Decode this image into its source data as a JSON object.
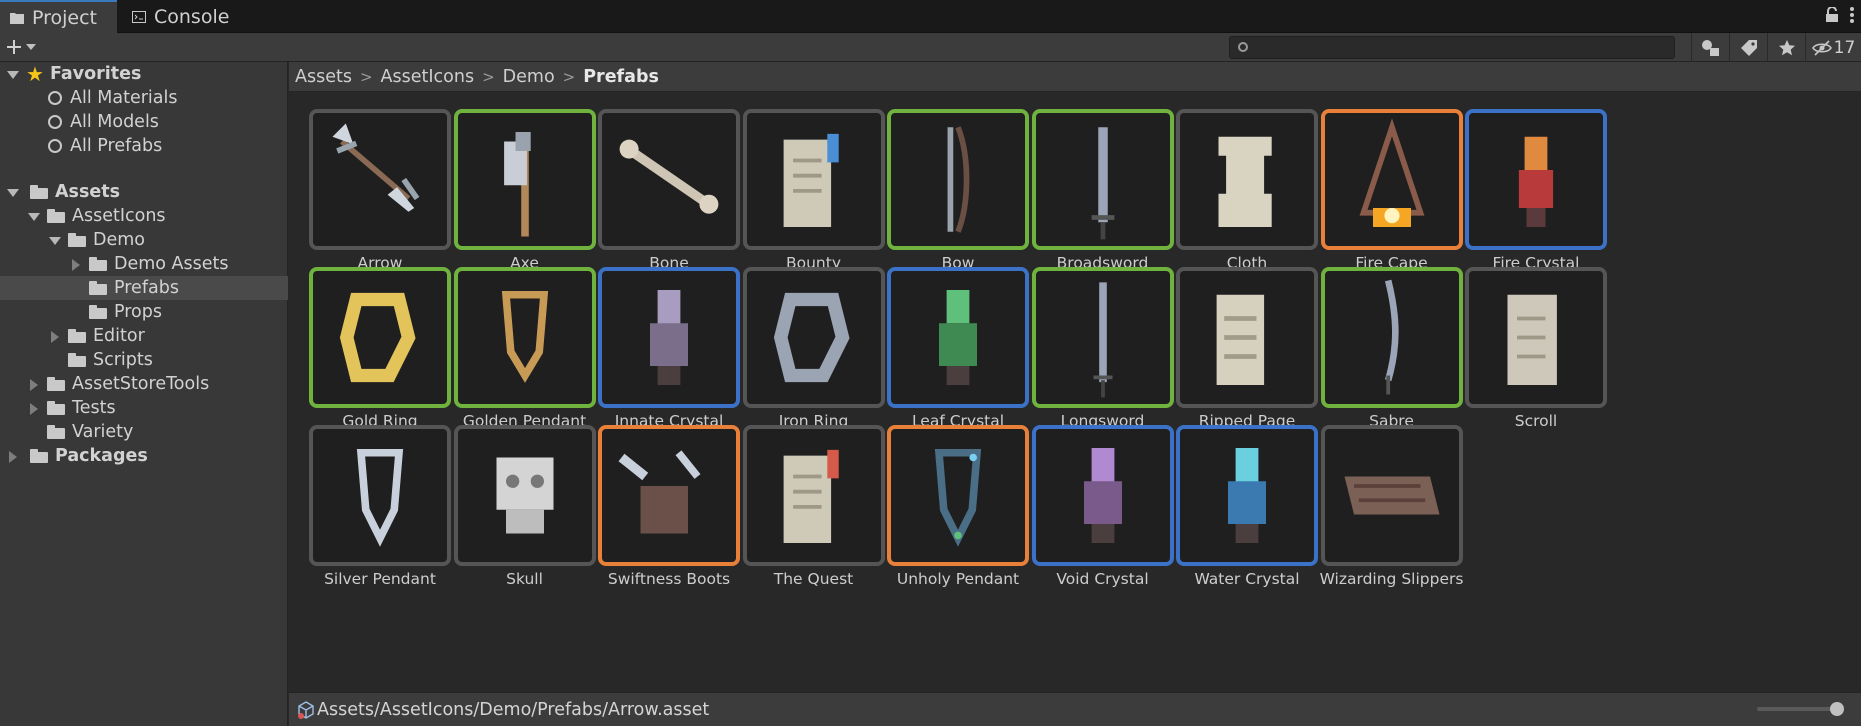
{
  "tabs": [
    {
      "label": "Project",
      "icon": "folder-icon",
      "active": true
    },
    {
      "label": "Console",
      "icon": "console-icon",
      "active": false
    }
  ],
  "toolbar": {
    "search_value": "",
    "hidden_count": "17"
  },
  "tree": {
    "favorites_label": "Favorites",
    "favorites": [
      "All Materials",
      "All Models",
      "All Prefabs"
    ],
    "assets_label": "Assets",
    "asset_icons": "AssetIcons",
    "demo": "Demo",
    "demo_assets": "Demo Assets",
    "prefabs": "Prefabs",
    "props": "Props",
    "editor": "Editor",
    "scripts": "Scripts",
    "asset_store_tools": "AssetStoreTools",
    "tests": "Tests",
    "variety": "Variety",
    "packages": "Packages"
  },
  "breadcrumb": [
    "Assets",
    "AssetIcons",
    "Demo",
    "Prefabs"
  ],
  "items": [
    {
      "label": "Arrow",
      "rarity": "common"
    },
    {
      "label": "Axe",
      "rarity": "uncommon"
    },
    {
      "label": "Bone",
      "rarity": "common"
    },
    {
      "label": "Bounty",
      "rarity": "common"
    },
    {
      "label": "Bow",
      "rarity": "uncommon"
    },
    {
      "label": "Broadsword",
      "rarity": "uncommon"
    },
    {
      "label": "Cloth",
      "rarity": "common"
    },
    {
      "label": "Fire Cape",
      "rarity": "legendary"
    },
    {
      "label": "Fire Crystal",
      "rarity": "rare"
    },
    {
      "label": "Gold Ring",
      "rarity": "uncommon"
    },
    {
      "label": "Golden Pendant",
      "rarity": "uncommon"
    },
    {
      "label": "Innate Crystal",
      "rarity": "rare"
    },
    {
      "label": "Iron Ring",
      "rarity": "common"
    },
    {
      "label": "Leaf Crystal",
      "rarity": "rare"
    },
    {
      "label": "Longsword",
      "rarity": "uncommon"
    },
    {
      "label": "Ripped Page",
      "rarity": "common"
    },
    {
      "label": "Sabre",
      "rarity": "uncommon"
    },
    {
      "label": "Scroll",
      "rarity": "common"
    },
    {
      "label": "Silver Pendant",
      "rarity": "common"
    },
    {
      "label": "Skull",
      "rarity": "common"
    },
    {
      "label": "Swiftness Boots",
      "rarity": "legendary"
    },
    {
      "label": "The Quest",
      "rarity": "common"
    },
    {
      "label": "Unholy Pendant",
      "rarity": "legendary"
    },
    {
      "label": "Void Crystal",
      "rarity": "rare"
    },
    {
      "label": "Water Crystal",
      "rarity": "rare"
    },
    {
      "label": "Wizarding Slippers",
      "rarity": "common"
    }
  ],
  "rarity_colors": {
    "common": "#555555",
    "uncommon": "#6fb23e",
    "rare": "#3b72c8",
    "legendary": "#e8803a"
  },
  "status": {
    "path": "Assets/AssetIcons/Demo/Prefabs/Arrow.asset",
    "zoom": 1.0
  }
}
